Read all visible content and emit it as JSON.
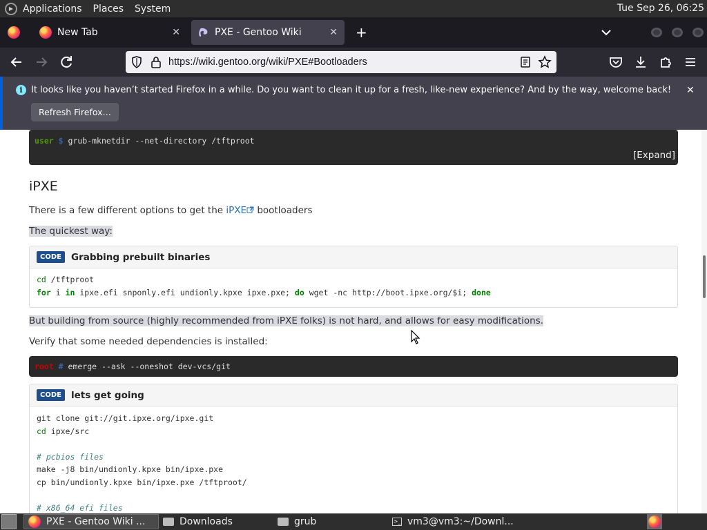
{
  "top_panel": {
    "menus": [
      "Applications",
      "Places",
      "System"
    ],
    "clock": "Tue Sep 26, 06:25"
  },
  "tabs": [
    {
      "title": "New Tab",
      "close": "✕"
    },
    {
      "title": "PXE - Gentoo Wiki",
      "close": "✕"
    }
  ],
  "toolbar": {
    "new_tab": "+",
    "url": "https://wiki.gentoo.org/wiki/PXE#Bootloaders"
  },
  "notification": {
    "info": "i",
    "message": "It looks like you haven’t started Firefox in a while. Do you want to clean it up for a fresh, like-new experience? And by the way, welcome back!",
    "refresh_label": "Refresh Firefox…",
    "close": "✕"
  },
  "page": {
    "term1": {
      "user": "user",
      "sym": "$",
      "cmd": "grub-mknetdir --net-directory /tftproot",
      "expand": "[Expand]"
    },
    "heading": "iPXE",
    "intro_before": "There is a few different options to get the ",
    "intro_link": "iPXE",
    "intro_after": " bootloaders",
    "quickest": "The quickest way:",
    "code1": {
      "badge": "CODE",
      "title": "Grabbing prebuilt binaries",
      "line1_cmd": "cd",
      "line1_rest": " /tftproot",
      "line2_for": "for",
      "line2_mid1": " i ",
      "line2_in": "in",
      "line2_mid2": " ipxe.efi snponly.efi undionly.kpxe ipxe.pxe; ",
      "line2_do": "do",
      "line2_mid3": " wget -nc http://boot.ipxe.org/$i; ",
      "line2_done": "done"
    },
    "building": "But building from source (highly recommended from iPXE folks) is not hard, and allows for easy modifications.",
    "verify": "Verify that some needed dependencies is installed:",
    "term2": {
      "user": "root",
      "sym": "#",
      "cmd": "emerge --ask --oneshot dev-vcs/git"
    },
    "code2": {
      "badge": "CODE",
      "title": "lets get going",
      "l1": "git clone git://git.ipxe.org/ipxe.git",
      "l2_cmd": "cd",
      "l2_rest": " ipxe/src",
      "l3": "",
      "l4": "# pcbios files",
      "l5": "make -j8 bin/undionly.kpxe bin/ipxe.pxe",
      "l6": "cp bin/undionly.kpxe bin/ipxe.pxe /tftproot/",
      "l7": "",
      "l8": "# x86_64 efi files"
    }
  },
  "taskbar": {
    "items": [
      "PXE - Gentoo Wiki ...",
      "Downloads",
      "grub",
      "vm3@vm3:~/Downl..."
    ]
  }
}
